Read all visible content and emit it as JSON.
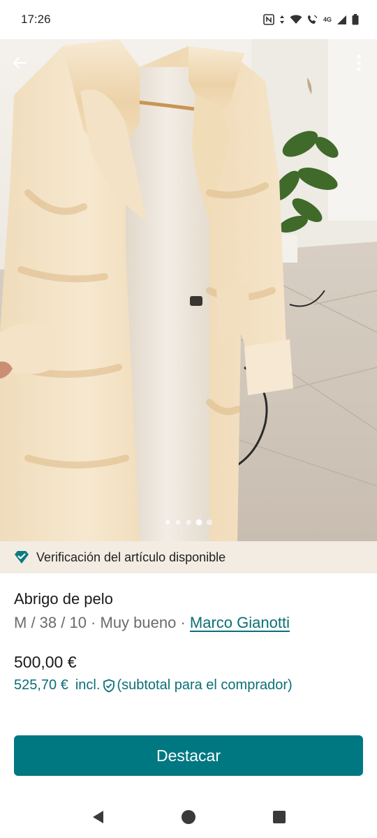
{
  "status_bar": {
    "time": "17:26",
    "network_label": "4G",
    "icons": [
      "nfc-icon",
      "data-arrows-icon",
      "wifi-icon",
      "wifi-calling-icon",
      "signal-icon",
      "battery-icon"
    ]
  },
  "photo": {
    "description_icon": "fur-coat-photo",
    "carousel_count": 5,
    "carousel_active_index": 3
  },
  "toolbar": {
    "back_icon": "arrow-left-icon",
    "more_icon": "more-vertical-icon"
  },
  "verification": {
    "text": "Verificación del artículo disponible",
    "icon": "diamond-check-icon"
  },
  "item": {
    "title": "Abrigo de pelo",
    "meta_prefix": "M / 38 / 10 · Muy bueno · ",
    "brand": "Marco Gianotti",
    "price": "500,00 €",
    "buyer_price": "525,70 €",
    "buyer_incl": "incl.",
    "buyer_note": "(subtotal para el comprador)"
  },
  "actions": {
    "primary_label": "Destacar"
  },
  "colors": {
    "accent": "#007882",
    "link": "#0b6f76",
    "banner_bg": "#f3ece2"
  }
}
